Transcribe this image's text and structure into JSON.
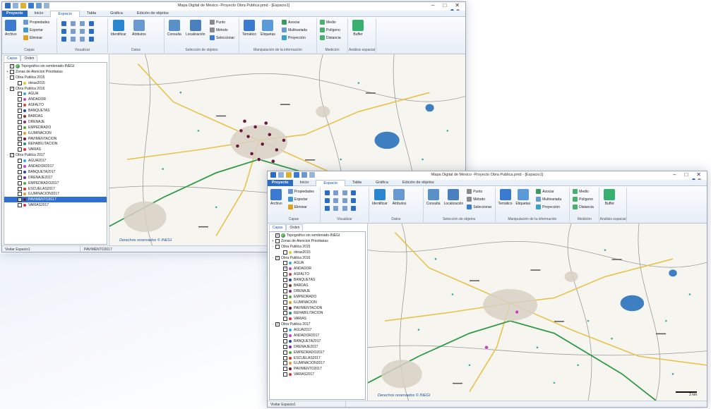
{
  "app": {
    "title": "Mapa Digital de México -Proyecto Obra Publica.pmd - [Espacio1]"
  },
  "tabs": [
    "Proyecto",
    "Inicio",
    "Espacio",
    "Tabla",
    "Gráfica",
    "Edición de objetos"
  ],
  "active_tab": "Espacio",
  "ribbon": {
    "archivo": "Archivo",
    "propiedades": "Propiedades",
    "exportar": "Exportar",
    "eliminar": "Eliminar",
    "identificar": "Identificar",
    "atributos": "Atributos",
    "consulta": "Consulta",
    "localizacion": "Localización",
    "punto": "Punto",
    "metodo": "Método",
    "seleccionar": "Seleccionar",
    "tematico": "Temático",
    "etiquetas": "Etiquetas",
    "asociar": "Asociar",
    "multivariada": "Multivariada",
    "proyeccion": "Proyección",
    "medio": "Medio",
    "poligono": "Polígono",
    "distancia": "Distancia",
    "buffer": "Buffer",
    "groups": {
      "capas": "Capas",
      "visualizar": "Visualizar",
      "datos": "Datos",
      "seleccion": "Selección de objetos",
      "manipulacion": "Manipulación de la información",
      "medicion": "Medición",
      "analisis": "Análisis espacial"
    }
  },
  "panel_tabs": [
    "Capas",
    "Orden"
  ],
  "layers_w1": [
    {
      "label": "Topográfico sin sombreado-INEGI",
      "level": 0,
      "checked": true,
      "icon": "globe",
      "exp": ""
    },
    {
      "label": "Zonas de Atencion Prioritarias",
      "level": 0,
      "checked": false,
      "icon": "",
      "exp": "+"
    },
    {
      "label": "Obra Publica 2015",
      "level": 0,
      "checked": false,
      "icon": "",
      "exp": "-"
    },
    {
      "label": "obras2015",
      "level": 1,
      "checked": false,
      "icon": "#e6c63a",
      "exp": ""
    },
    {
      "label": "Obra Publica 2016",
      "level": 0,
      "checked": true,
      "icon": "",
      "exp": "-"
    },
    {
      "label": "AGUA",
      "level": 1,
      "checked": false,
      "icon": "#38a8d8",
      "exp": ""
    },
    {
      "label": "ANDADOR",
      "level": 1,
      "checked": false,
      "icon": "#c845c0",
      "exp": ""
    },
    {
      "label": "ASFALTO",
      "level": 1,
      "checked": false,
      "icon": "#d94040",
      "exp": ""
    },
    {
      "label": "BANQUETAS",
      "level": 1,
      "checked": false,
      "icon": "#2a3fa8",
      "exp": ""
    },
    {
      "label": "BARDAS",
      "level": 1,
      "checked": false,
      "icon": "#7a3b1e",
      "exp": ""
    },
    {
      "label": "DRENAJE",
      "level": 1,
      "checked": false,
      "icon": "#8a2a8a",
      "exp": ""
    },
    {
      "label": "EMPEDRADO",
      "level": 1,
      "checked": false,
      "icon": "#5aa832",
      "exp": ""
    },
    {
      "label": "ILUMINACION",
      "level": 1,
      "checked": false,
      "icon": "#e89a2a",
      "exp": ""
    },
    {
      "label": "PAVIMENTACION",
      "level": 1,
      "checked": true,
      "icon": "#6a1a3a",
      "exp": ""
    },
    {
      "label": "REHABILITACION",
      "level": 1,
      "checked": false,
      "icon": "#2a8a8a",
      "exp": ""
    },
    {
      "label": "VARIAS",
      "level": 1,
      "checked": false,
      "icon": "#d83030",
      "exp": ""
    },
    {
      "label": "Obra Publica 2017",
      "level": 0,
      "checked": true,
      "icon": "",
      "exp": "-"
    },
    {
      "label": "AGUA2017",
      "level": 1,
      "checked": false,
      "icon": "#38a8d8",
      "exp": ""
    },
    {
      "label": "ANDADOR2017",
      "level": 1,
      "checked": false,
      "icon": "#c845c0",
      "exp": ""
    },
    {
      "label": "BANQUETA2017",
      "level": 1,
      "checked": false,
      "icon": "#2a3fa8",
      "exp": ""
    },
    {
      "label": "DRENAJE2017",
      "level": 1,
      "checked": false,
      "icon": "#8a2a8a",
      "exp": ""
    },
    {
      "label": "EMPEDRADO2017",
      "level": 1,
      "checked": false,
      "icon": "#5aa832",
      "exp": ""
    },
    {
      "label": "ESCUELAS2017",
      "level": 1,
      "checked": false,
      "icon": "#d83030",
      "exp": ""
    },
    {
      "label": "ILUMINACION2017",
      "level": 1,
      "checked": false,
      "icon": "#e89a2a",
      "exp": ""
    },
    {
      "label": "PAVIMENTO2017",
      "level": 1,
      "checked": true,
      "icon": "#6a1a3a",
      "exp": "",
      "selected": true
    },
    {
      "label": "VARIAS2017",
      "level": 1,
      "checked": false,
      "icon": "#d83030",
      "exp": ""
    }
  ],
  "layers_w2": [
    {
      "label": "Topográfico sin sombreado-INEGI",
      "level": 0,
      "checked": true,
      "icon": "globe",
      "exp": ""
    },
    {
      "label": "Zonas de Atencion Prioritarias",
      "level": 0,
      "checked": false,
      "icon": "",
      "exp": "+"
    },
    {
      "label": "Obra Publica 2015",
      "level": 0,
      "checked": false,
      "icon": "",
      "exp": "-"
    },
    {
      "label": "obras2015",
      "level": 1,
      "checked": false,
      "icon": "#e6c63a",
      "exp": ""
    },
    {
      "label": "Obra Publica 2016",
      "level": 0,
      "checked": true,
      "icon": "",
      "exp": "-"
    },
    {
      "label": "AGUA",
      "level": 1,
      "checked": false,
      "icon": "#38a8d8",
      "exp": ""
    },
    {
      "label": "ANDADOR",
      "level": 1,
      "checked": true,
      "icon": "#c845c0",
      "exp": ""
    },
    {
      "label": "ASFALTO",
      "level": 1,
      "checked": false,
      "icon": "#d94040",
      "exp": ""
    },
    {
      "label": "BANQUETAS",
      "level": 1,
      "checked": false,
      "icon": "#2a3fa8",
      "exp": ""
    },
    {
      "label": "BARDAS",
      "level": 1,
      "checked": false,
      "icon": "#7a3b1e",
      "exp": ""
    },
    {
      "label": "DRENAJE",
      "level": 1,
      "checked": false,
      "icon": "#8a2a8a",
      "exp": ""
    },
    {
      "label": "EMPEDRADO",
      "level": 1,
      "checked": false,
      "icon": "#5aa832",
      "exp": ""
    },
    {
      "label": "ILUMINACION",
      "level": 1,
      "checked": false,
      "icon": "#e89a2a",
      "exp": ""
    },
    {
      "label": "PAVIMENTACION",
      "level": 1,
      "checked": false,
      "icon": "#6a1a3a",
      "exp": ""
    },
    {
      "label": "REHABILITACION",
      "level": 1,
      "checked": false,
      "icon": "#2a8a8a",
      "exp": ""
    },
    {
      "label": "VARIAS",
      "level": 1,
      "checked": false,
      "icon": "#d83030",
      "exp": ""
    },
    {
      "label": "Obra Publica 2017",
      "level": 0,
      "checked": true,
      "icon": "",
      "exp": "-"
    },
    {
      "label": "AGUA2017",
      "level": 1,
      "checked": false,
      "icon": "#38a8d8",
      "exp": ""
    },
    {
      "label": "ANDADOR2017",
      "level": 1,
      "checked": true,
      "icon": "#c845c0",
      "exp": ""
    },
    {
      "label": "BANQUETA2017",
      "level": 1,
      "checked": false,
      "icon": "#2a3fa8",
      "exp": ""
    },
    {
      "label": "DRENAJE2017",
      "level": 1,
      "checked": false,
      "icon": "#8a2a8a",
      "exp": ""
    },
    {
      "label": "EMPEDRADO2017",
      "level": 1,
      "checked": false,
      "icon": "#5aa832",
      "exp": ""
    },
    {
      "label": "ESCUELAS2017",
      "level": 1,
      "checked": false,
      "icon": "#d83030",
      "exp": ""
    },
    {
      "label": "ILUMINACION2017",
      "level": 1,
      "checked": false,
      "icon": "#e89a2a",
      "exp": ""
    },
    {
      "label": "PAVIMENTO2017",
      "level": 1,
      "checked": false,
      "icon": "#6a1a3a",
      "exp": ""
    },
    {
      "label": "VARIAS2017",
      "level": 1,
      "checked": false,
      "icon": "#d83030",
      "exp": ""
    }
  ],
  "map": {
    "credit": "Derechos reservados © INEGI",
    "scale_label": "2 km"
  },
  "status_w1": {
    "left": "Visitar Espacio1",
    "right": "PAVIMENTO2017"
  },
  "status_w2": {
    "left": "Visitar Espacio1"
  },
  "colors": {
    "accent": "#2b6cc4",
    "selection": "#2f6fd1",
    "road_primary": "#2f9a45",
    "road_secondary": "#e8c24a",
    "water": "#3d7fc0",
    "urban": "#d8d0c4",
    "marker_pavimento": "#6a1a3a",
    "marker_andador": "#c845c0"
  }
}
